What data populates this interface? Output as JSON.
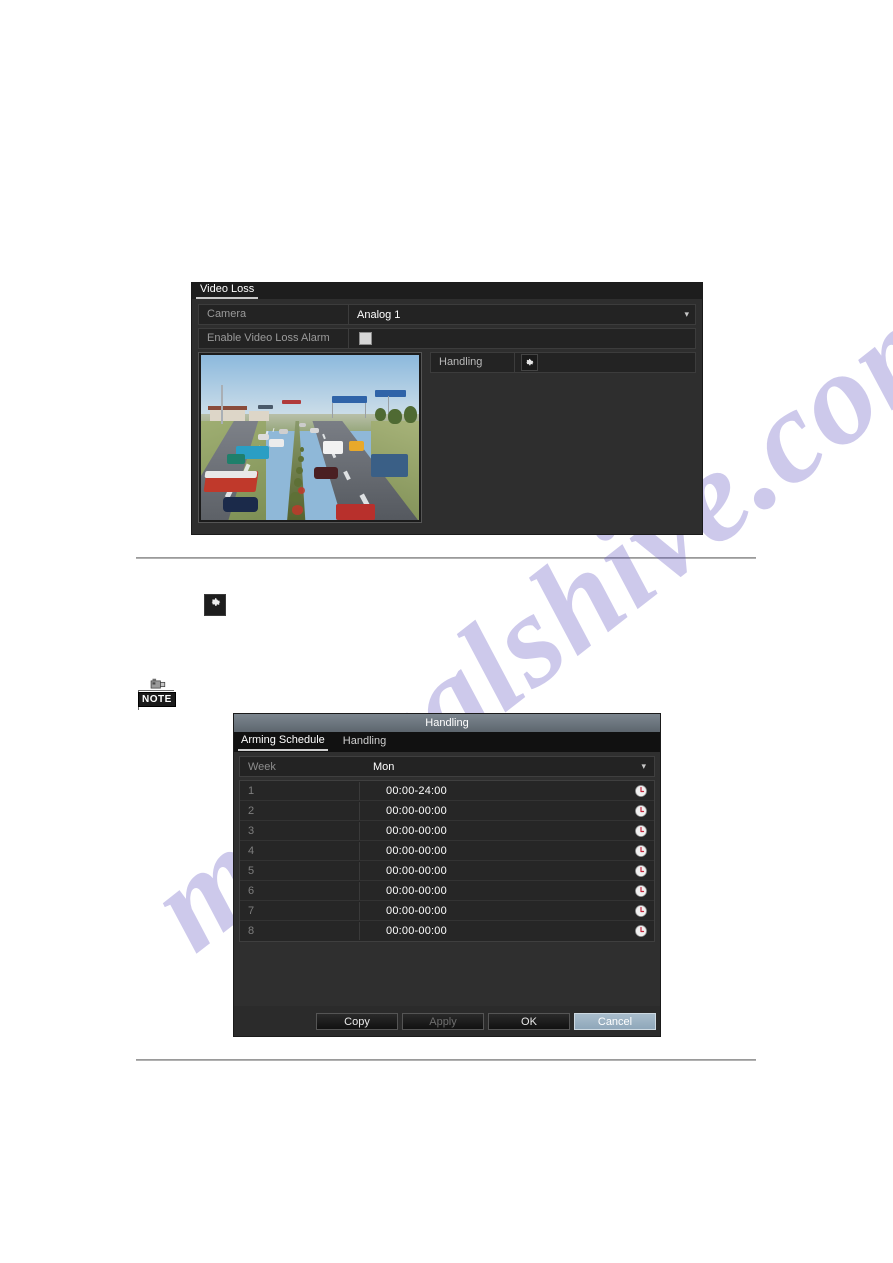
{
  "watermark": {
    "text": "manualshive.com"
  },
  "video_loss_panel": {
    "tab_label": "Video Loss",
    "rows": [
      {
        "label": "Camera",
        "value": "Analog 1",
        "type": "select",
        "caret": "chevron-down-icon"
      },
      {
        "label": "Enable Video Loss Alarm",
        "value": "",
        "type": "checkbox",
        "checked": false
      }
    ],
    "handling": {
      "label": "Handling",
      "button_icon": "gear-icon"
    },
    "preview": {
      "alt": "live camera preview of a highway with buses, trucks and cars"
    }
  },
  "inline_gear_figure": {
    "icon": "gear-icon"
  },
  "note_icon": {
    "label": "NOTE",
    "icon": "note-camera-icon"
  },
  "handling_dialog": {
    "title": "Handling",
    "tabs": [
      {
        "label": "Arming Schedule",
        "active": true
      },
      {
        "label": "Handling",
        "active": false
      }
    ],
    "week": {
      "label": "Week",
      "value": "Mon",
      "caret": "chevron-down-icon"
    },
    "schedule_rows": [
      {
        "index": "1",
        "time": "00:00-24:00",
        "icon": "clock-icon"
      },
      {
        "index": "2",
        "time": "00:00-00:00",
        "icon": "clock-icon"
      },
      {
        "index": "3",
        "time": "00:00-00:00",
        "icon": "clock-icon"
      },
      {
        "index": "4",
        "time": "00:00-00:00",
        "icon": "clock-icon"
      },
      {
        "index": "5",
        "time": "00:00-00:00",
        "icon": "clock-icon"
      },
      {
        "index": "6",
        "time": "00:00-00:00",
        "icon": "clock-icon"
      },
      {
        "index": "7",
        "time": "00:00-00:00",
        "icon": "clock-icon"
      },
      {
        "index": "8",
        "time": "00:00-00:00",
        "icon": "clock-icon"
      }
    ],
    "buttons": [
      {
        "label": "Copy",
        "state": "normal"
      },
      {
        "label": "Apply",
        "state": "disabled"
      },
      {
        "label": "OK",
        "state": "normal"
      },
      {
        "label": "Cancel",
        "state": "highlighted"
      }
    ]
  },
  "colors": {
    "panel_bg": "#2e2e2e",
    "row_bg": "#232323",
    "label_gray": "#9a9a9a",
    "value_white": "#ffffff",
    "title_gradient_top": "#7c868f",
    "title_gradient_bottom": "#5d666e",
    "primary_button": "#a9bdcc",
    "clock_red": "#c2243a",
    "watermark": "#5b4fbf"
  }
}
